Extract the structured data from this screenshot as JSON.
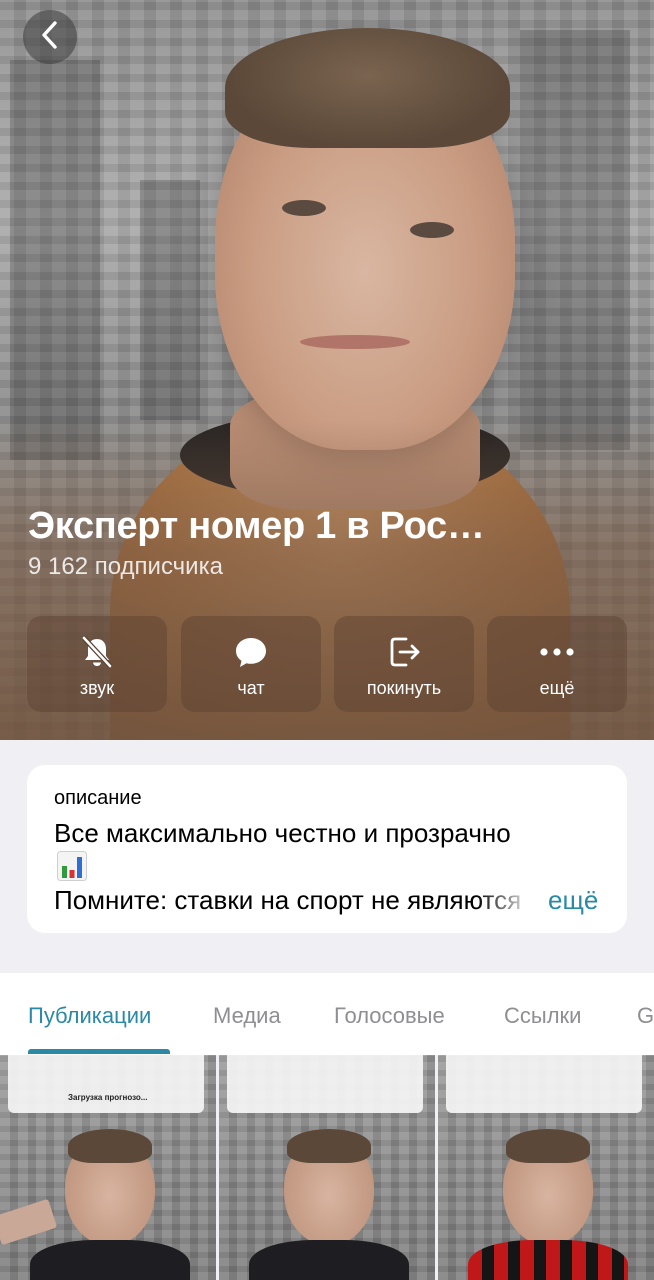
{
  "header": {
    "title": "Эксперт номер 1 в Рос…",
    "subscribers": "9 162 подписчика"
  },
  "actions": [
    {
      "label": "звук",
      "icon": "bell-off-icon"
    },
    {
      "label": "чат",
      "icon": "chat-bubble-icon"
    },
    {
      "label": "покинуть",
      "icon": "leave-icon"
    },
    {
      "label": "ещё",
      "icon": "more-dots-icon"
    }
  ],
  "description": {
    "caption": "описание",
    "line1": "Все максимально честно и прозрачно",
    "emoji_icon": "bar-chart-emoji-icon",
    "line2": "Помните: ставки на спорт не являются",
    "more": "ещё"
  },
  "tabs": [
    {
      "label": "Публикации",
      "active": true
    },
    {
      "label": "Медиа",
      "active": false
    },
    {
      "label": "Голосовые",
      "active": false
    },
    {
      "label": "Ссылки",
      "active": false
    },
    {
      "label": "G",
      "active": false
    }
  ],
  "thumbnails": [
    {
      "caption": "Загрузка прогнозо..."
    },
    {
      "caption": ""
    },
    {
      "caption": ""
    }
  ],
  "colors": {
    "accent": "#2a8aa5",
    "background": "#efeff4"
  }
}
